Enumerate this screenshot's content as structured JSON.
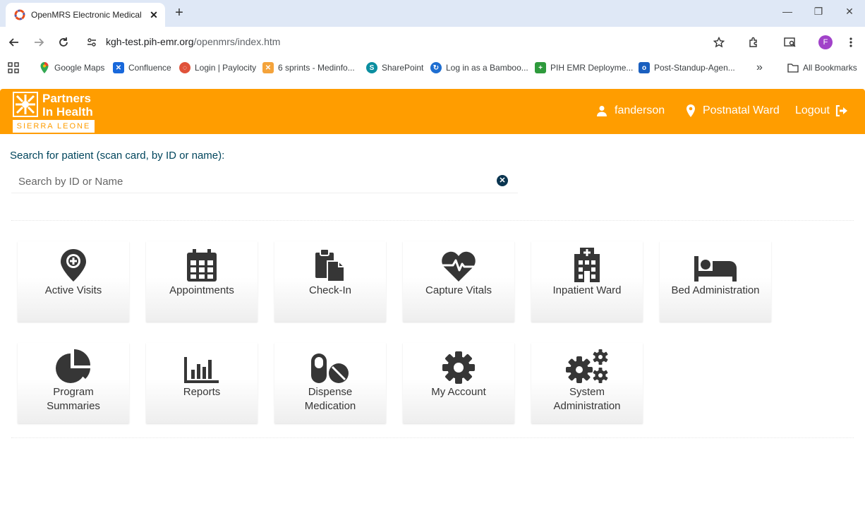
{
  "browser": {
    "tab_title": "OpenMRS Electronic Medical R",
    "url_host": "kgh-test.pih-emr.org",
    "url_path": "/openmrs/index.htm",
    "profile_initial": "F",
    "bookmarks": [
      {
        "label": "Google Maps",
        "icon": "google-maps-icon"
      },
      {
        "label": "Confluence",
        "icon": "confluence-icon"
      },
      {
        "label": "Login | Paylocity",
        "icon": "paylocity-icon"
      },
      {
        "label": "6 sprints - Medinfo...",
        "icon": "sprints-icon"
      },
      {
        "label": "SharePoint",
        "icon": "sharepoint-icon"
      },
      {
        "label": "Log in as a Bamboo...",
        "icon": "bamboo-icon"
      },
      {
        "label": "PIH EMR Deployme...",
        "icon": "pih-icon"
      },
      {
        "label": "Post-Standup-Agen...",
        "icon": "outlook-icon"
      }
    ],
    "all_bookmarks": "All Bookmarks",
    "overflow": "»"
  },
  "header": {
    "logo_line1": "Partners",
    "logo_line2": "In Health",
    "logo_band": "SIERRA LEONE",
    "user": "fanderson",
    "location": "Postnatal Ward",
    "logout": "Logout"
  },
  "search": {
    "label": "Search for patient (scan card, by ID or name):",
    "placeholder": "Search by ID or Name",
    "value": ""
  },
  "apps": [
    {
      "label": "Active Visits",
      "icon": "map-marker-icon"
    },
    {
      "label": "Appointments",
      "icon": "calendar-icon"
    },
    {
      "label": "Check-In",
      "icon": "paste-icon"
    },
    {
      "label": "Capture Vitals",
      "icon": "heartbeat-icon"
    },
    {
      "label": "Inpatient Ward",
      "icon": "hospital-icon"
    },
    {
      "label": "Bed Administration",
      "icon": "bed-icon"
    },
    {
      "label": "Program\nSummaries",
      "icon": "pie-chart-icon"
    },
    {
      "label": "Reports",
      "icon": "bar-chart-icon"
    },
    {
      "label": "Dispense\nMedication",
      "icon": "pills-icon"
    },
    {
      "label": "My Account",
      "icon": "gear-icon"
    },
    {
      "label": "System\nAdministration",
      "icon": "gears-icon"
    }
  ],
  "colors": {
    "header": "#ff9d00",
    "label": "#00455c",
    "icon": "#363636"
  }
}
